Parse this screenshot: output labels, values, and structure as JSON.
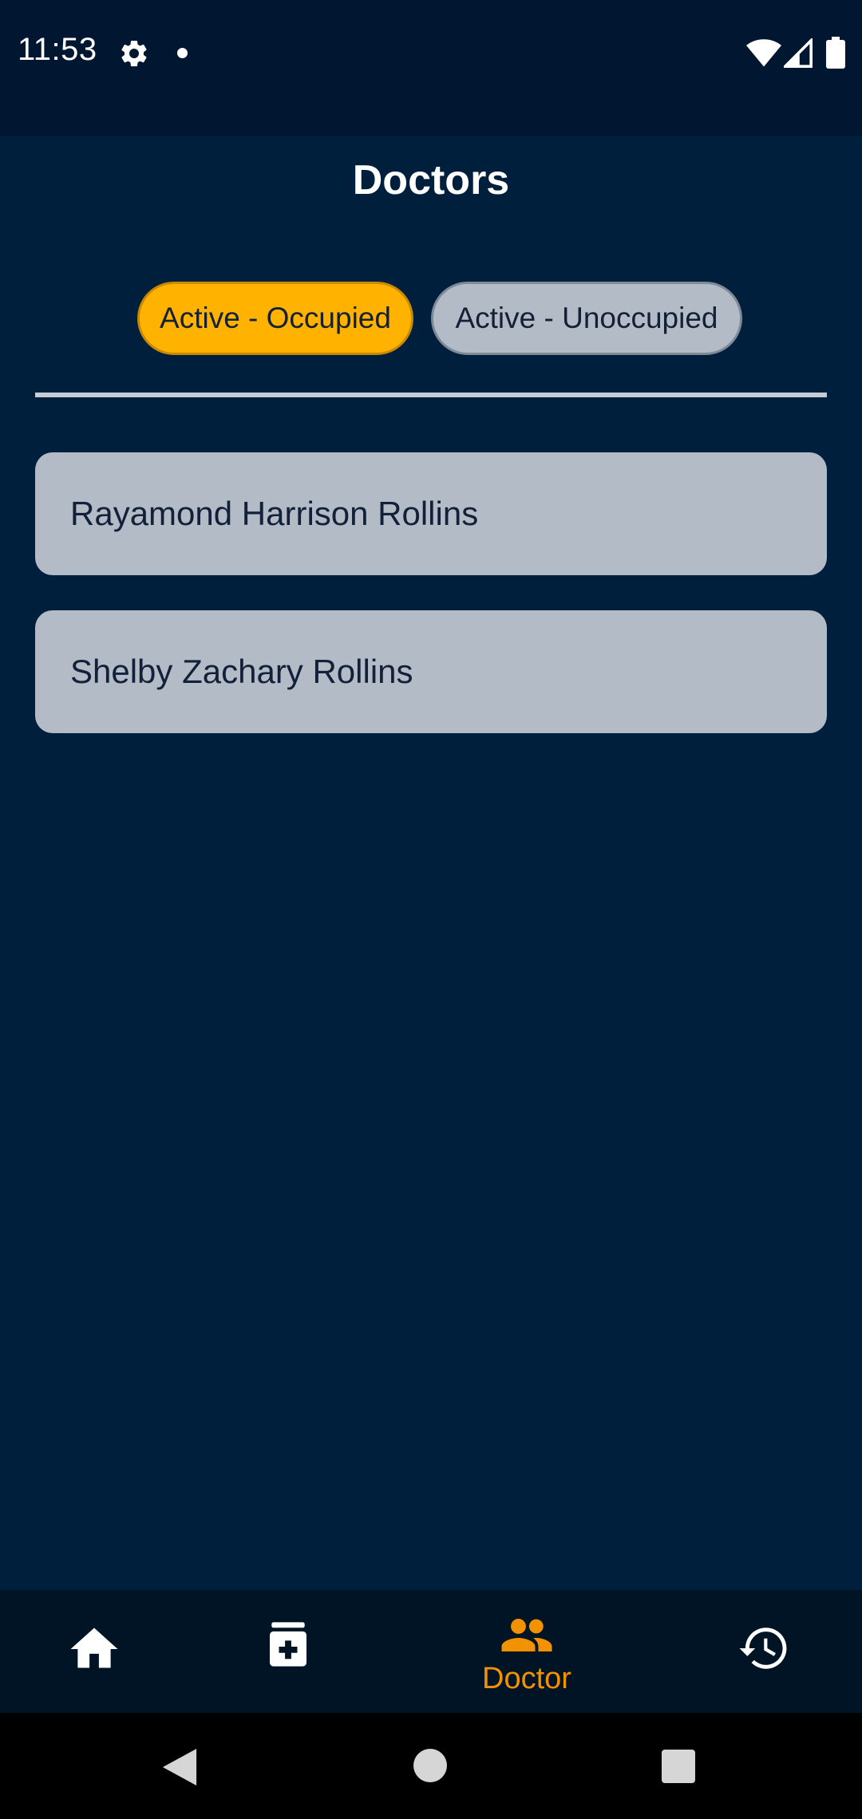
{
  "status_bar": {
    "time": "11:53",
    "icons": [
      "gear-icon",
      "notification-dot",
      "wifi-icon",
      "signal-icon",
      "battery-icon"
    ]
  },
  "header": {
    "title": "Doctors"
  },
  "filters": {
    "occupied_label": "Active - Occupied",
    "unoccupied_label": "Active - Unoccupied",
    "selected": "Active - Occupied"
  },
  "doctors": [
    {
      "name": "Rayamond Harrison Rollins"
    },
    {
      "name": "Shelby Zachary Rollins"
    }
  ],
  "bottom_nav": {
    "items": [
      {
        "icon": "home-icon",
        "label": ""
      },
      {
        "icon": "medicine-icon",
        "label": ""
      },
      {
        "icon": "people-icon",
        "label": "Doctor"
      },
      {
        "icon": "history-icon",
        "label": ""
      }
    ],
    "active": "Doctor"
  },
  "colors": {
    "background": "#001f3d",
    "accent": "#ffb300",
    "active_nav": "#f39200",
    "card": "#b3bbc6"
  }
}
